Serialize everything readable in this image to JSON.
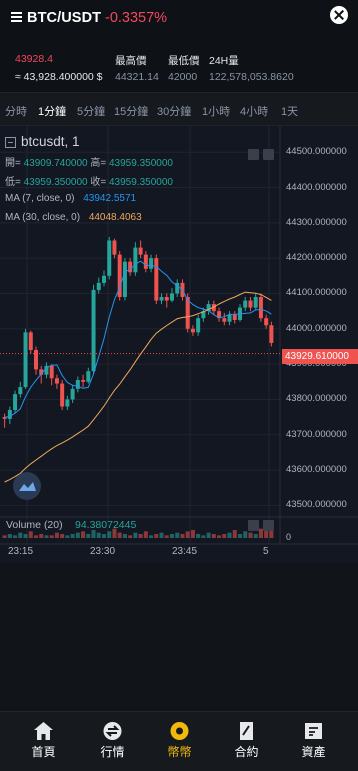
{
  "header": {
    "pair": "BTC/USDT",
    "change": "-0.3357%"
  },
  "stats": {
    "last_price": "43928.4",
    "approx_price": "≈ 43,928.400000 $",
    "high_label": "最高價",
    "high_value": "44321.14",
    "low_label": "最低價",
    "low_value": "42000",
    "volume_label": "24H量",
    "volume_value": "122,578,053.8620"
  },
  "intervals": {
    "items": [
      "分時",
      "1分鐘",
      "5分鐘",
      "15分鐘",
      "30分鐘",
      "1小時",
      "4小時",
      "1天"
    ],
    "active": "1分鐘"
  },
  "chart_data": {
    "type": "candlestick",
    "symbol": "btcusdt, 1",
    "ohlc": {
      "open_label": "開=",
      "open": "43909.740000",
      "high_label": "高=",
      "high": "43959.350000",
      "low_label": "低=",
      "low": "43959.350000",
      "close_label": "收=",
      "close": "43959.350000"
    },
    "ma7": {
      "label": "MA (7, close, 0)",
      "value": "43942.5571",
      "color": "#2196f3"
    },
    "ma30": {
      "label": "MA (30, close, 0)",
      "value": "44048.4063",
      "color": "#f0a85c"
    },
    "current_price": "43929.610000",
    "y_ticks": [
      "44500.000000",
      "44400.000000",
      "44300.000000",
      "44200.000000",
      "44100.000000",
      "44000.000000",
      "43900.000000",
      "43800.000000",
      "43700.000000",
      "43600.000000",
      "43500.000000"
    ],
    "ylim": [
      43470,
      44560
    ],
    "x_ticks": [
      "23:15",
      "23:30",
      "23:45",
      "5"
    ],
    "up_color": "#26a69a",
    "down_color": "#ef5350",
    "candles": [
      [
        43750,
        43745,
        43760,
        43720
      ],
      [
        43745,
        43770,
        43780,
        43730
      ],
      [
        43770,
        43815,
        43825,
        43760
      ],
      [
        43815,
        43835,
        43850,
        43805
      ],
      [
        43835,
        43990,
        44000,
        43830
      ],
      [
        43990,
        43940,
        43995,
        43930
      ],
      [
        43940,
        43885,
        43950,
        43870
      ],
      [
        43885,
        43870,
        43895,
        43845
      ],
      [
        43870,
        43895,
        43905,
        43860
      ],
      [
        43895,
        43860,
        43900,
        43840
      ],
      [
        43860,
        43845,
        43870,
        43830
      ],
      [
        43845,
        43780,
        43855,
        43770
      ],
      [
        43780,
        43800,
        43810,
        43770
      ],
      [
        43800,
        43830,
        43840,
        43790
      ],
      [
        43830,
        43855,
        43865,
        43820
      ],
      [
        43855,
        43850,
        43870,
        43835
      ],
      [
        43850,
        43880,
        43890,
        43845
      ],
      [
        43880,
        44110,
        44125,
        43870
      ],
      [
        44110,
        44130,
        44145,
        44100
      ],
      [
        44130,
        44150,
        44165,
        44120
      ],
      [
        44150,
        44250,
        44260,
        44140
      ],
      [
        44250,
        44210,
        44255,
        44200
      ],
      [
        44210,
        44090,
        44220,
        44080
      ],
      [
        44090,
        44190,
        44200,
        44080
      ],
      [
        44190,
        44160,
        44200,
        44150
      ],
      [
        44160,
        44230,
        44245,
        44150
      ],
      [
        44230,
        44210,
        44250,
        44200
      ],
      [
        44210,
        44170,
        44220,
        44160
      ],
      [
        44170,
        44200,
        44210,
        44160
      ],
      [
        44200,
        44080,
        44210,
        44070
      ],
      [
        44080,
        44090,
        44100,
        44070
      ],
      [
        44090,
        44080,
        44100,
        44060
      ],
      [
        44080,
        44100,
        44115,
        44075
      ],
      [
        44100,
        44130,
        44140,
        44090
      ],
      [
        44130,
        44090,
        44140,
        44080
      ],
      [
        44090,
        44000,
        44100,
        43990
      ],
      [
        44000,
        43990,
        44010,
        43980
      ],
      [
        43990,
        44030,
        44040,
        43980
      ],
      [
        44030,
        44050,
        44060,
        44020
      ],
      [
        44050,
        44070,
        44080,
        44040
      ],
      [
        44070,
        44050,
        44080,
        44040
      ],
      [
        44050,
        44030,
        44060,
        44020
      ],
      [
        44030,
        44020,
        44045,
        44010
      ],
      [
        44020,
        44040,
        44050,
        44010
      ],
      [
        44040,
        44025,
        44050,
        44015
      ],
      [
        44025,
        44060,
        44070,
        44020
      ],
      [
        44060,
        44080,
        44090,
        44050
      ],
      [
        44080,
        44060,
        44090,
        44050
      ],
      [
        44060,
        44090,
        44100,
        44055
      ],
      [
        44090,
        44030,
        44100,
        44020
      ],
      [
        44030,
        44010,
        44040,
        44000
      ],
      [
        44010,
        43960,
        44020,
        43950
      ]
    ],
    "volume": {
      "label": "Volume (20)",
      "value": "94.38072445",
      "zero_tick": "0",
      "values": [
        2,
        3,
        2,
        4,
        3,
        5,
        2,
        3,
        2,
        2,
        4,
        3,
        2,
        3,
        4,
        5,
        3,
        6,
        4,
        3,
        5,
        7,
        4,
        3,
        2,
        4,
        3,
        5,
        2,
        3,
        4,
        2,
        3,
        4,
        3,
        5,
        6,
        3,
        2,
        4,
        3,
        2,
        3,
        4,
        6,
        3,
        5,
        4,
        3,
        7,
        9,
        8
      ]
    }
  },
  "tabbar": {
    "items": [
      {
        "label": "首頁",
        "icon": "home-icon"
      },
      {
        "label": "行情",
        "icon": "market-icon"
      },
      {
        "label": "幣幣",
        "icon": "exchange-icon"
      },
      {
        "label": "合約",
        "icon": "contract-icon"
      },
      {
        "label": "資產",
        "icon": "assets-icon"
      }
    ],
    "active": "幣幣",
    "active_color": "#f0b90b"
  }
}
